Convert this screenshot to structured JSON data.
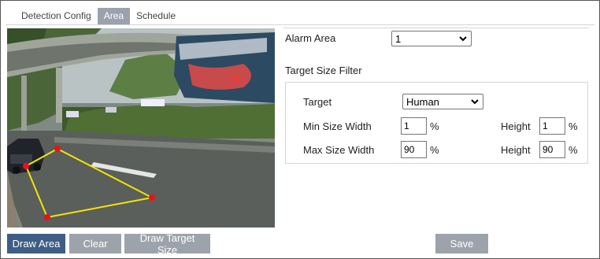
{
  "tabs": [
    {
      "label": "Detection Config",
      "active": false
    },
    {
      "label": "Area",
      "active": true
    },
    {
      "label": "Schedule",
      "active": false
    }
  ],
  "buttons": {
    "draw_area": "Draw Area",
    "clear": "Clear",
    "draw_target_size": "Draw Target Size",
    "save": "Save"
  },
  "alarm_area": {
    "label": "Alarm Area",
    "value": "1"
  },
  "target_size_filter": {
    "title": "Target Size Filter",
    "target_label": "Target",
    "target_value": "Human",
    "min_size_width_label": "Min Size Width",
    "min_width": "1",
    "min_height_label": "Height",
    "min_height": "1",
    "max_size_width_label": "Max Size Width",
    "max_width": "90",
    "max_height_label": "Height",
    "max_height": "90",
    "unit": "%"
  },
  "colors": {
    "tab_active_bg": "#9aa3ad",
    "primary_button": "#3e5e85",
    "secondary_button": "#9da3ab",
    "area_line": "#f2e600",
    "area_vertex": "#e8131a"
  }
}
